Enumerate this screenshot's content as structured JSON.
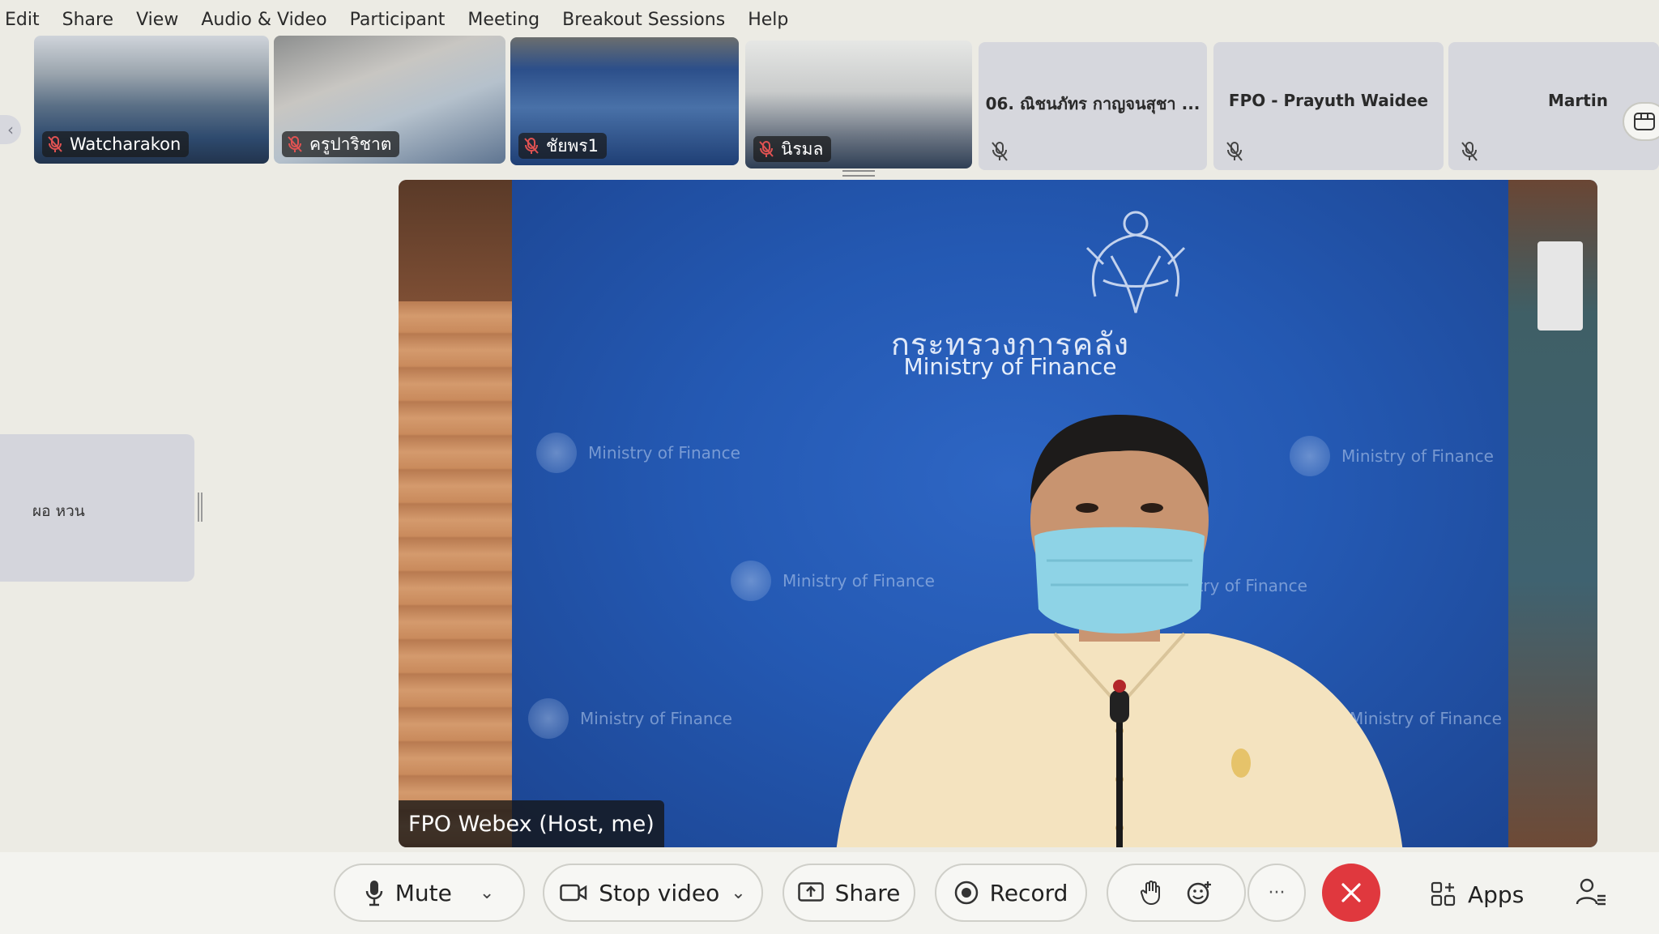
{
  "menu": [
    "Edit",
    "Share",
    "View",
    "Audio & Video",
    "Participant",
    "Meeting",
    "Breakout Sessions",
    "Help"
  ],
  "thumbnails": [
    {
      "name": "Watcharakon"
    },
    {
      "name": "ครูปาริชาต"
    },
    {
      "name": "ชัยพร1"
    },
    {
      "name": "นิรมล"
    }
  ],
  "tiles": [
    {
      "name": "06. ณิชนภัทร กาญจนสุชา ..."
    },
    {
      "name": "FPO - Prayuth Waidee"
    },
    {
      "name": "Martin"
    }
  ],
  "side_tile": {
    "name": "ผอ หวน"
  },
  "main_video": {
    "backdrop_title_th": "กระทรวงการคลัง",
    "backdrop_title_en": "Ministry of Finance",
    "watermark": "Ministry of Finance",
    "host_label": "FPO Webex (Host, me)"
  },
  "toolbar": {
    "mute": "Mute",
    "stop_video": "Stop video",
    "share": "Share",
    "record": "Record",
    "more": "···",
    "apps": "Apps"
  },
  "colors": {
    "end_call": "#e0383e",
    "backdrop_blue": "#2459b3",
    "muted_red": "#e05252"
  }
}
